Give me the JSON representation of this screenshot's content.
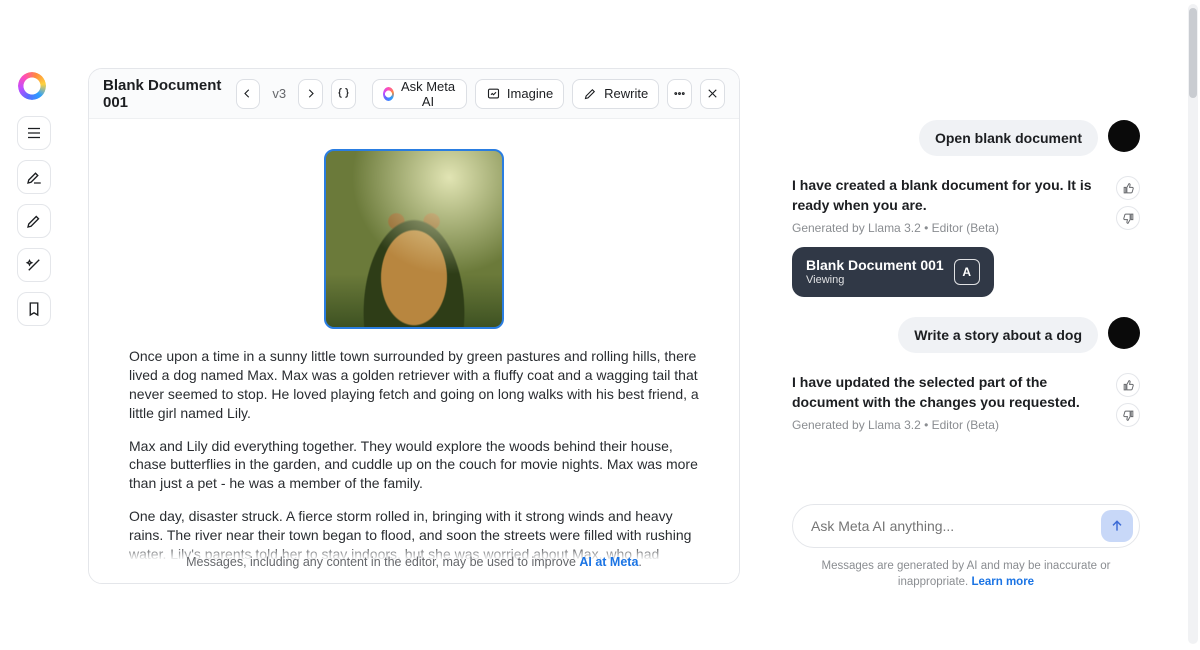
{
  "rail": {
    "items": [
      "menu",
      "compose",
      "pencil",
      "wand",
      "library"
    ]
  },
  "document": {
    "title": "Blank Document 001",
    "version": "v3",
    "toolbar": {
      "ask": "Ask Meta AI",
      "imagine": "Imagine",
      "rewrite": "Rewrite"
    },
    "image_alt": "golden-retriever-in-meadow",
    "paragraphs": [
      "Once upon a time in a sunny little town surrounded by green pastures and rolling hills, there lived a dog named Max. Max was a golden retriever with a fluffy coat and a wagging tail that never seemed to stop. He loved playing fetch and going on long walks with his best friend, a little girl named Lily.",
      "Max and Lily did everything together. They would explore the woods behind their house, chase butterflies in the garden, and cuddle up on the couch for movie nights. Max was more than just a pet - he was a member of the family.",
      "One day, disaster struck. A fierce storm rolled in, bringing with it strong winds and heavy rains. The river near their town began to flood, and soon the streets were filled with rushing water. Lily's parents told her to stay indoors, but she was worried about Max, who had slipped out of"
    ],
    "footer_text": "Messages, including any content in the editor, may be used to improve ",
    "footer_link": "AI at Meta"
  },
  "chat": {
    "messages": [
      {
        "role": "user",
        "text": "Open blank document"
      },
      {
        "role": "ai",
        "text": "I have created a blank document for you. It is ready when you are.",
        "meta": "Generated by Llama 3.2 • Editor (Beta)",
        "chip": {
          "title": "Blank Document 001",
          "sub": "Viewing",
          "badge": "A"
        }
      },
      {
        "role": "user",
        "text": "Write a story about a dog"
      },
      {
        "role": "ai",
        "text": "I have updated the selected part of the document with the changes you requested.",
        "meta": "Generated by Llama 3.2 • Editor (Beta)"
      }
    ],
    "input_placeholder": "Ask Meta AI anything...",
    "disclaimer_text": "Messages are generated by AI and may be inaccurate or inappropriate. ",
    "disclaimer_link": "Learn more"
  }
}
